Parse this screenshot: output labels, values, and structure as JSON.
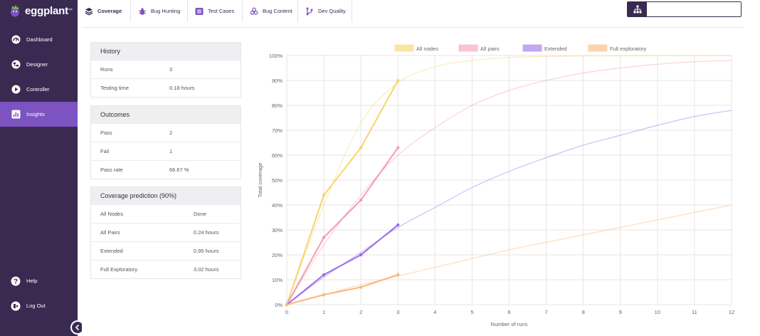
{
  "app": {
    "logo_text": "eggplant",
    "logo_tm": "™"
  },
  "sidebar": {
    "items": [
      {
        "label": "Dashboard",
        "icon": "dashboard-icon"
      },
      {
        "label": "Designer",
        "icon": "designer-icon"
      },
      {
        "label": "Controller",
        "icon": "play-icon"
      },
      {
        "label": "Insights",
        "icon": "chart-icon",
        "active": true
      }
    ],
    "bottom": [
      {
        "label": "Help",
        "icon": "help-icon"
      },
      {
        "label": "Log Out",
        "icon": "logout-icon"
      }
    ]
  },
  "tabs": [
    {
      "label": "Coverage",
      "icon": "layers-icon",
      "active": true
    },
    {
      "label": "Bug Hunting",
      "icon": "bug-icon"
    },
    {
      "label": "Test Cases",
      "icon": "list-icon"
    },
    {
      "label": "Bug Content",
      "icon": "biohazard-icon"
    },
    {
      "label": "Dev Quality",
      "icon": "branch-icon"
    }
  ],
  "search": {
    "placeholder": "",
    "value": ""
  },
  "history": {
    "title": "History",
    "rows": [
      {
        "label": "Runs",
        "value": "3"
      },
      {
        "label": "Testing time",
        "value": "0.18 hours"
      }
    ]
  },
  "outcomes": {
    "title": "Outcomes",
    "rows": [
      {
        "label": "Pass",
        "value": "2"
      },
      {
        "label": "Fail",
        "value": "1"
      },
      {
        "label": "Pass rate",
        "value": "66.67 %"
      }
    ]
  },
  "coverage_prediction": {
    "title": "Coverage prediction (90%)",
    "rows": [
      {
        "label": "All Nodes",
        "value": "Done"
      },
      {
        "label": "All Pairs",
        "value": "0.24 hours"
      },
      {
        "label": "Extended",
        "value": "0.95 hours"
      },
      {
        "label": "Full Exploratory",
        "value": "3.02 hours"
      }
    ]
  },
  "colors": {
    "sidebar_bg": "#3a2a52",
    "active_purple": "#7c53c1",
    "all_nodes": "#f7d56b",
    "all_pairs": "#f49db1",
    "extended": "#9c6ee8",
    "full_exploratory": "#f7b97a"
  },
  "chart_data": {
    "type": "line",
    "xlabel": "Number of runs",
    "ylabel": "Total coverage",
    "xlim": [
      0,
      12
    ],
    "ylim": [
      0,
      100
    ],
    "x_ticks": [
      "0",
      "1",
      "2",
      "3",
      "4",
      "5",
      "6",
      "7",
      "8",
      "9",
      "10",
      "11",
      "12"
    ],
    "y_ticks": [
      "0%",
      "10%",
      "20%",
      "30%",
      "40%",
      "50%",
      "60%",
      "70%",
      "80%",
      "90%",
      "100%"
    ],
    "legend_position": "top",
    "grid": true,
    "series": [
      {
        "name": "All nodes",
        "color": "#f7d56b",
        "x": [
          0,
          1,
          2,
          3
        ],
        "values": [
          0,
          44,
          63,
          90
        ],
        "predicted_x": [
          0,
          1,
          2,
          3,
          4,
          5,
          6,
          7,
          8,
          9,
          10,
          11,
          12
        ],
        "predicted": [
          0,
          40,
          73,
          89,
          95.5,
          98,
          99.2,
          99.6,
          99.8,
          99.9,
          100,
          100,
          100
        ]
      },
      {
        "name": "All pairs",
        "color": "#f49db1",
        "x": [
          0,
          1,
          2,
          3
        ],
        "values": [
          0,
          27,
          42,
          63
        ],
        "predicted_x": [
          0,
          1,
          2,
          3,
          4,
          5,
          6,
          7,
          8,
          9,
          10,
          11,
          12
        ],
        "predicted": [
          0,
          24,
          44,
          60,
          71,
          80,
          86,
          90,
          93,
          95,
          96.5,
          97.5,
          98
        ]
      },
      {
        "name": "Extended",
        "color": "#9c6ee8",
        "x": [
          0,
          1,
          2,
          3
        ],
        "values": [
          0,
          12,
          20,
          32
        ],
        "predicted_x": [
          0,
          1,
          2,
          3,
          4,
          5,
          6,
          7,
          8,
          9,
          10,
          11,
          12
        ],
        "predicted": [
          0,
          11,
          21,
          31,
          39,
          47,
          53.5,
          59,
          64,
          68,
          72,
          75.5,
          78
        ]
      },
      {
        "name": "Full exploratory",
        "color": "#f7b97a",
        "x": [
          0,
          1,
          2,
          3
        ],
        "values": [
          0,
          4,
          7,
          12
        ],
        "predicted_x": [
          0,
          1,
          2,
          3,
          4,
          5,
          6,
          7,
          8,
          9,
          10,
          11,
          12
        ],
        "predicted": [
          0,
          4,
          8,
          11.5,
          15,
          18.5,
          22,
          25,
          28,
          31,
          34,
          37,
          40
        ]
      }
    ]
  }
}
